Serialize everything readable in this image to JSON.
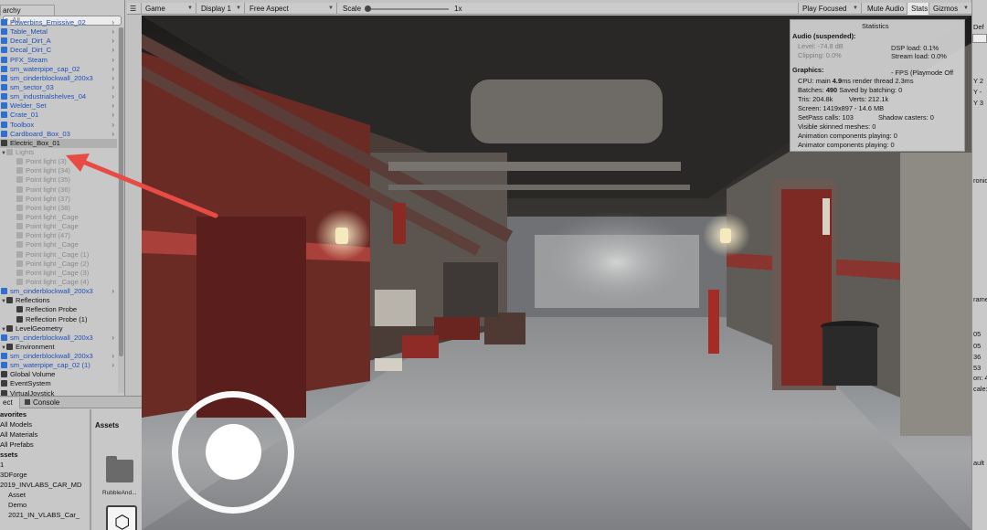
{
  "hierarchy": {
    "tab_label": "archy",
    "search_placeholder": "All",
    "items": [
      {
        "label": "Powerbins_Emissive_02",
        "style": "blue"
      },
      {
        "label": "Table_Metal",
        "style": "blue"
      },
      {
        "label": "Decal_Dirt_A",
        "style": "blue"
      },
      {
        "label": "Decal_Dirt_C",
        "style": "blue"
      },
      {
        "label": "PFX_Steam",
        "style": "blue"
      },
      {
        "label": "sm_waterpipe_cap_02",
        "style": "blue"
      },
      {
        "label": "sm_cinderblockwall_200x3",
        "style": "blue"
      },
      {
        "label": "sm_sector_03",
        "style": "blue"
      },
      {
        "label": "sm_industrialshelves_04",
        "style": "blue"
      },
      {
        "label": "Welder_Set",
        "style": "blue"
      },
      {
        "label": "Crate_01",
        "style": "blue"
      },
      {
        "label": "Toolbox",
        "style": "blue"
      },
      {
        "label": "Cardboard_Box_03",
        "style": "blue"
      },
      {
        "label": "Electric_Box_01",
        "style": "black"
      },
      {
        "label": "Lights",
        "style": "gray"
      },
      {
        "label": "Point light (3)",
        "style": "gray"
      },
      {
        "label": "Point light (34)",
        "style": "gray"
      },
      {
        "label": "Point light (35)",
        "style": "gray"
      },
      {
        "label": "Point light (36)",
        "style": "gray"
      },
      {
        "label": "Point light (37)",
        "style": "gray"
      },
      {
        "label": "Point light (38)",
        "style": "gray"
      },
      {
        "label": "Point light _Cage",
        "style": "gray"
      },
      {
        "label": "Point light _Cage",
        "style": "gray"
      },
      {
        "label": "Point light (47)",
        "style": "gray"
      },
      {
        "label": "Point light _Cage",
        "style": "gray"
      },
      {
        "label": "Point light _Cage (1)",
        "style": "gray"
      },
      {
        "label": "Point light _Cage (2)",
        "style": "gray"
      },
      {
        "label": "Point light _Cage (3)",
        "style": "gray"
      },
      {
        "label": "Point light _Cage (4)",
        "style": "gray"
      },
      {
        "label": "sm_cinderblockwall_200x3",
        "style": "blue"
      },
      {
        "label": "Reflections",
        "style": "black"
      },
      {
        "label": "Reflection Probe",
        "style": "black"
      },
      {
        "label": "Reflection Probe (1)",
        "style": "black"
      },
      {
        "label": "LevelGeometry",
        "style": "black"
      },
      {
        "label": "sm_cinderblockwall_200x3",
        "style": "blue"
      },
      {
        "label": "Environment",
        "style": "black"
      },
      {
        "label": "sm_cinderblockwall_200x3",
        "style": "blue"
      },
      {
        "label": "sm_waterpipe_cap_02 (1)",
        "style": "blue"
      },
      {
        "label": "Global Volume",
        "style": "black"
      },
      {
        "label": "EventSystem",
        "style": "black"
      },
      {
        "label": "VirtualJoystick",
        "style": "black"
      }
    ]
  },
  "project": {
    "tab_project": "ect",
    "tab_console": "Console",
    "tree": [
      {
        "label": "avorites",
        "head": true
      },
      {
        "label": "All Models"
      },
      {
        "label": "All Materials"
      },
      {
        "label": "All Prefabs"
      },
      {
        "label": "ssets",
        "head": true
      },
      {
        "label": "1"
      },
      {
        "label": "3DForge"
      },
      {
        "label": "2019_INVLABS_CAR_MD"
      },
      {
        "label": "Asset"
      },
      {
        "label": "Demo"
      },
      {
        "label": "2021_IN_VLABS_Car_"
      }
    ],
    "assets_title": "Assets",
    "asset_items": [
      {
        "label": "RubbleAnd..."
      }
    ]
  },
  "toolbar": {
    "game_label": "Game",
    "display_label": "Display 1",
    "aspect_label": "Free Aspect",
    "scale_label": "Scale",
    "scale_value": "1x",
    "scale_fraction": 0.0,
    "play_focus_label": "Play Focused",
    "mute_label": "Mute Audio",
    "stats_label": "Stats",
    "gizmos_label": "Gizmos"
  },
  "stats": {
    "title": "Statistics",
    "audio_header": "Audio (suspended):",
    "level": "Level: -74.8 dB",
    "dsp_load": "DSP load: 0.1%",
    "clipping": "Clipping: 0.0%",
    "stream_load": "Stream load: 0.0%",
    "graphics_header": "Graphics:",
    "fps": "- FPS (Playmode Off",
    "cpu_prefix": "CPU: main ",
    "cpu_main": "4.9",
    "cpu_suffix": "ms  render thread 2.3ms",
    "batches_prefix": "Batches: ",
    "batches": "490",
    "batches_suffix": "   Saved by batching: 0",
    "tris": "Tris: 204.8k",
    "verts": "Verts: 212.1k",
    "screen": "Screen: 1419x897 - 14.6 MB",
    "setpass": "SetPass calls: 103",
    "shadow_casters": "Shadow casters: 0",
    "skinned": "Visible skinned meshes: 0",
    "anim_comp": "Animation components playing: 0",
    "animator_comp": "Animator components playing: 0"
  },
  "inspector": {
    "labels": [
      "Def",
      "Y",
      "Y",
      "Y",
      "ronic",
      "rame",
      "05",
      "05",
      "36",
      "53",
      "on: 4",
      "cale:",
      "ault"
    ],
    "values": [
      "2",
      "-",
      "3"
    ]
  },
  "colors": {
    "annotation_arrow": "#e84a44",
    "prefab_blue": "#2050b8",
    "joystick": "#ffffff"
  }
}
